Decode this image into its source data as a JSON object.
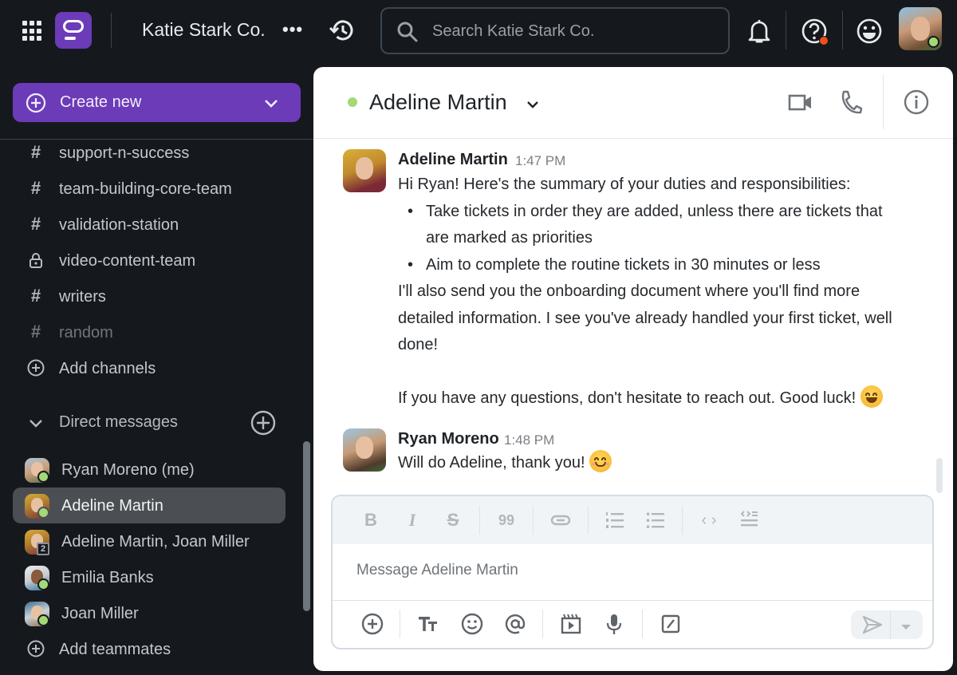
{
  "topbar": {
    "workspace_name": "Katie Stark Co.",
    "more_label": "•••",
    "search_placeholder": "Search Katie Stark Co.",
    "icons": [
      "apps-grid-icon",
      "app-logo",
      "history-icon",
      "search-icon",
      "bell-icon",
      "help-icon",
      "emoji-status-icon",
      "user-avatar"
    ],
    "help_badge_color": "#f04e1d",
    "status_color": "#a3d977"
  },
  "sidebar": {
    "create_new_label": "Create new",
    "accent_color": "#6c3bb8",
    "channels": [
      {
        "label": "support-n-success",
        "icon": "hash",
        "muted": false
      },
      {
        "label": "team-building-core-team",
        "icon": "hash",
        "muted": false
      },
      {
        "label": "validation-station",
        "icon": "hash",
        "muted": false
      },
      {
        "label": "video-content-team",
        "icon": "lock",
        "muted": false
      },
      {
        "label": "writers",
        "icon": "hash",
        "muted": false
      },
      {
        "label": "random",
        "icon": "hash",
        "muted": true
      }
    ],
    "add_channels_label": "Add channels",
    "direct_messages_label": "Direct messages",
    "dms": [
      {
        "label": "Ryan Moreno (me)",
        "online": true,
        "active": false
      },
      {
        "label": "Adeline Martin",
        "online": true,
        "active": true
      },
      {
        "label": "Adeline Martin, Joan Miller",
        "online": false,
        "group_count": "2",
        "active": false
      },
      {
        "label": "Emilia Banks",
        "online": true,
        "active": false
      },
      {
        "label": "Joan Miller",
        "online": true,
        "active": false
      }
    ],
    "add_teammates_label": "Add teammates"
  },
  "channel": {
    "title": "Adeline Martin",
    "online": true
  },
  "messages": [
    {
      "author": "Adeline Martin",
      "time": "1:47 PM",
      "intro": "Hi Ryan! Here's the summary of your duties and responsibilities:",
      "bullets": [
        "Take tickets in order they are added, unless there are tickets that are marked as priorities",
        "Aim to complete the routine tickets in 30 minutes or less"
      ],
      "para1": "I'll also send you the onboarding document where you'll find more detailed information. I see you've already handled your first ticket, well done!",
      "para2": "If you have any questions, don't hesitate to reach out. Good luck!",
      "emoji": "grinning-face-with-smiling-eyes"
    },
    {
      "author": "Ryan Moreno",
      "time": "1:48 PM",
      "text": "Will do Adeline, thank you!",
      "emoji": "smiling-face-with-smiling-eyes"
    }
  ],
  "composer": {
    "placeholder": "Message Adeline Martin",
    "format_buttons": [
      "bold",
      "italic",
      "strikethrough",
      "quote",
      "link",
      "numbered-list",
      "bulleted-list",
      "code",
      "code-block"
    ],
    "action_buttons": [
      "attach",
      "formatting",
      "emoji",
      "mention",
      "video-clip",
      "voice",
      "slash-command"
    ],
    "labels": {
      "bold": "B",
      "italic": "I",
      "strike": "S",
      "quote": "99",
      "code": "‹ ›"
    }
  }
}
